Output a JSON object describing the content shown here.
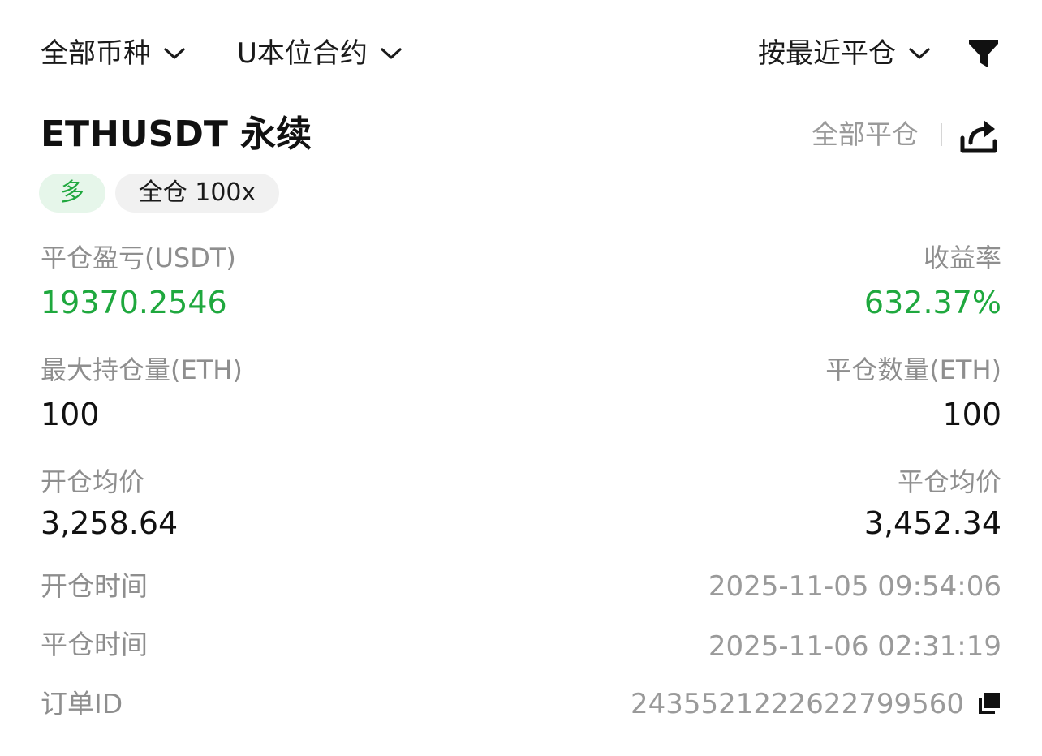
{
  "filters": {
    "coin": "全部币种",
    "contract": "U本位合约",
    "sort": "按最近平仓"
  },
  "position": {
    "symbol": "ETHUSDT 永续",
    "close_all": "全部平仓",
    "side_tag": "多",
    "margin_tag": "全仓 100x"
  },
  "stats": {
    "pnl_label": "平仓盈亏(USDT)",
    "pnl_value": "19370.2546",
    "roi_label": "收益率",
    "roi_value": "632.37%",
    "max_pos_label": "最大持仓量(ETH)",
    "max_pos_value": "100",
    "close_qty_label": "平仓数量(ETH)",
    "close_qty_value": "100",
    "open_price_label": "开仓均价",
    "open_price_value": "3,258.64",
    "close_price_label": "平仓均价",
    "close_price_value": "3,452.34"
  },
  "meta": {
    "open_time_label": "开仓时间",
    "open_time_value": "2025-11-05 09:54:06",
    "close_time_label": "平仓时间",
    "close_time_value": "2025-11-06 02:31:19",
    "order_id_label": "订单ID",
    "order_id_value": "2435521222622799560"
  },
  "icons": {
    "chevron": "chevron-down-icon",
    "filter": "filter-icon",
    "share": "share-icon",
    "copy": "copy-icon"
  },
  "colors": {
    "profit_green": "#1fa83e",
    "muted_text": "#8e8e8e"
  }
}
